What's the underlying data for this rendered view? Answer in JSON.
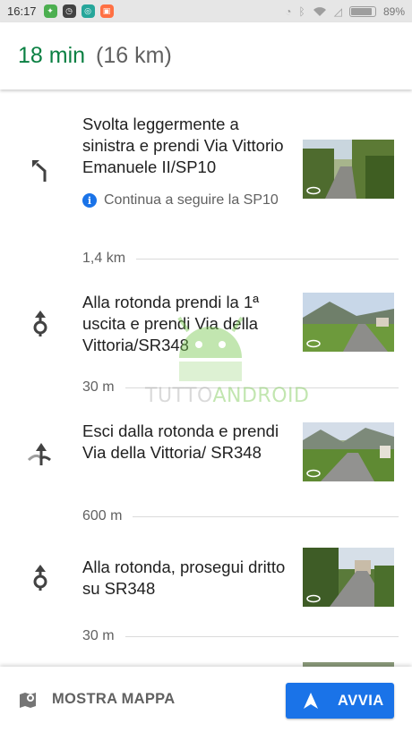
{
  "status_bar": {
    "time": "16:17",
    "battery": "89%",
    "battery_level": 0.89
  },
  "header": {
    "duration": "18 min",
    "distance": "(16 km)"
  },
  "steps": [
    {
      "instruction": "Svolta leggermente a sinistra e prendi Via Vittorio Emanuele II/SP10",
      "maneuver": "turn-slight-left-icon",
      "note": "Continua a seguire la SP10",
      "distance": "1,4 km"
    },
    {
      "instruction": "Alla rotonda prendi la 1ª uscita e prendi Via della Vittoria/SR348",
      "maneuver": "roundabout-icon",
      "distance": "30 m"
    },
    {
      "instruction": "Esci dalla rotonda e prendi Via della Vittoria/ SR348",
      "maneuver": "roundabout-exit-icon",
      "distance": "600 m"
    },
    {
      "instruction": "Alla rotonda, prosegui dritto su SR348",
      "maneuver": "roundabout-icon",
      "distance": "30 m"
    }
  ],
  "watermark": {
    "part1": "TUTTO",
    "part2": "ANDROID"
  },
  "bottom_bar": {
    "map_label": "MOSTRA MAPPA",
    "start_label": "AVVIA"
  },
  "colors": {
    "eta_green": "#0b8043",
    "accent_blue": "#1a73e8"
  }
}
